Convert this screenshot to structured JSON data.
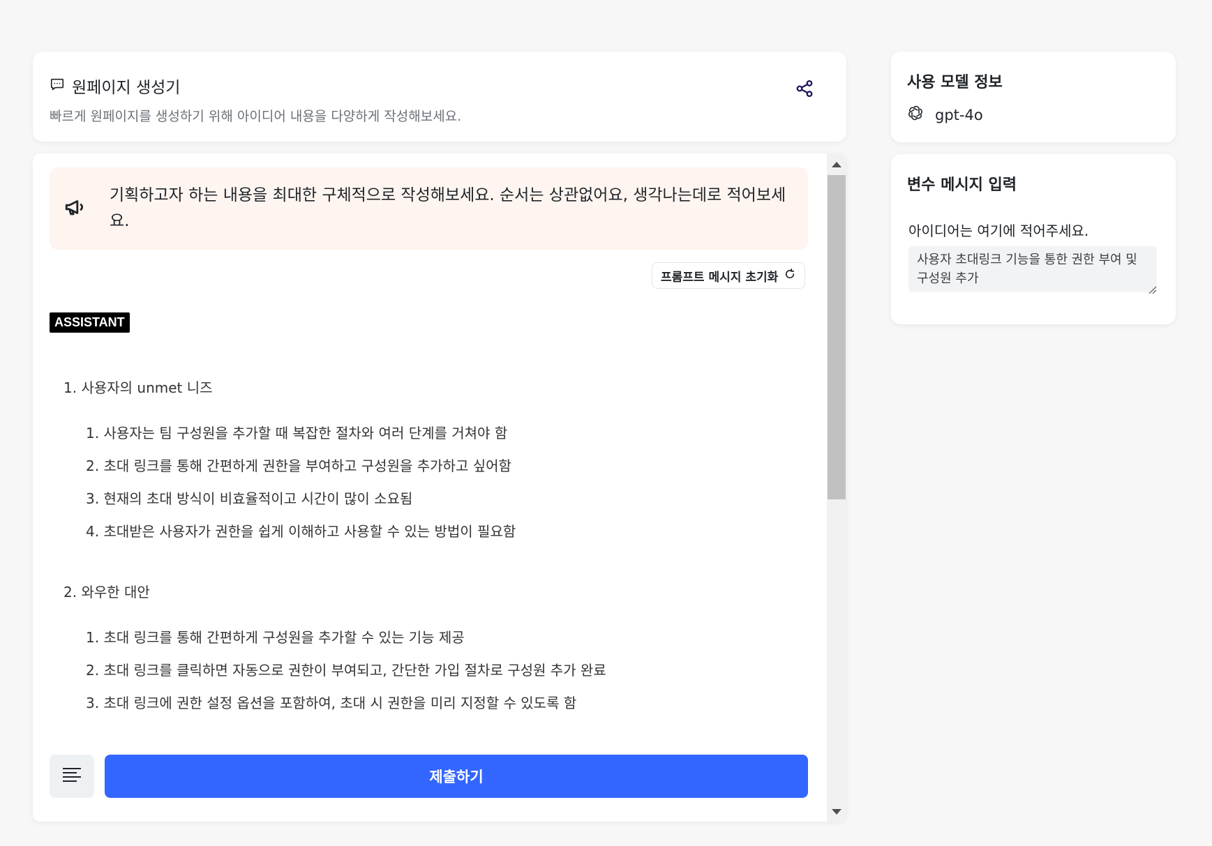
{
  "header": {
    "title": "원페이지 생성기",
    "subtitle": "빠르게 원페이지를 생성하기 위해 아이디어 내용을 다양하게 작성해보세요."
  },
  "notice": {
    "text": "기획하고자 하는 내용을 최대한 구체적으로 작성해보세요. 순서는 상관없어요, 생각나는데로 적어보세요."
  },
  "reset_button": {
    "label": "프롬프트 메시지 초기화"
  },
  "role_badge": "ASSISTANT",
  "content": {
    "sections": [
      {
        "title": "1. 사용자의 unmet 니즈",
        "items": [
          "1. 사용자는 팀 구성원을 추가할 때 복잡한 절차와 여러 단계를 거쳐야 함",
          "2. 초대 링크를 통해 간편하게 권한을 부여하고 구성원을 추가하고 싶어함",
          "3. 현재의 초대 방식이 비효율적이고 시간이 많이 소요됨",
          "4. 초대받은 사용자가 권한을 쉽게 이해하고 사용할 수 있는 방법이 필요함"
        ]
      },
      {
        "title": "2. 와우한 대안",
        "items": [
          "1. 초대 링크를 통해 간편하게 구성원을 추가할 수 있는 기능 제공",
          "2. 초대 링크를 클릭하면 자동으로 권한이 부여되고, 간단한 가입 절차로 구성원 추가 완료",
          "3. 초대 링크에 권한 설정 옵션을 포함하여, 초대 시 권한을 미리 지정할 수 있도록 함"
        ]
      }
    ]
  },
  "submit_button": {
    "label": "제출하기"
  },
  "model_panel": {
    "heading": "사용 모델 정보",
    "model_name": "gpt-4o"
  },
  "variable_panel": {
    "heading": "변수 메시지 입력",
    "field_label": "아이디어는 여기에 적어주세요.",
    "field_value": "사용자 초대링크 기능을 통한 권한 부여 및 구성원 추가"
  },
  "colors": {
    "accent": "#3366ff",
    "notice_bg": "#fef5f0",
    "badge_bg": "#000000"
  },
  "icons": {
    "header": "chat-bubble-icon",
    "share": "share-icon",
    "notice": "megaphone-icon",
    "reset": "refresh-icon",
    "format": "text-align-left-icon",
    "model": "openai-logo-icon"
  }
}
